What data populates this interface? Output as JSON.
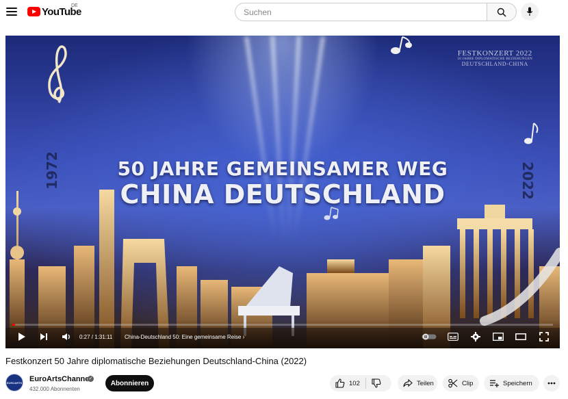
{
  "header": {
    "logo_text": "YouTube",
    "country_code": "DE",
    "search_placeholder": "Suchen"
  },
  "video": {
    "overlay_title_line1": "50 JAHRE GEMEINSAMER WEG",
    "overlay_title_line2": "CHINA DEUTSCHLAND",
    "overlay_event_line1": "FESTKONZERT 2022",
    "overlay_event_line2": "50 JAHRE DIPLOMATISCHE BEZIEHUNGEN",
    "overlay_event_line3": "DEUTSCHLAND-CHINA",
    "side_year_left": "1972",
    "side_year_right": "2022",
    "progress_fraction": 0.005
  },
  "player": {
    "time": "0:27 / 1:31:11",
    "chapter": "China-Deutschland 50: Eine gemeinsame Reise",
    "chapter_arrow": "›"
  },
  "title": "Festkonzert 50 Jahre diplomatische Beziehungen Deutschland-China (2022)",
  "channel": {
    "avatar_text": "EUROARTS",
    "name": "EuroArtsChannel",
    "verified_mark": "✓",
    "subscribers": "432.000 Abonnenten",
    "subscribe_label": "Abonnieren"
  },
  "actions": {
    "like_count": "102",
    "share_label": "Teilen",
    "clip_label": "Clip",
    "save_label": "Speichern"
  },
  "colors": {
    "brand_red": "#ff0000",
    "button_dark": "#0f0f0f",
    "pill_bg": "#f2f2f2"
  }
}
